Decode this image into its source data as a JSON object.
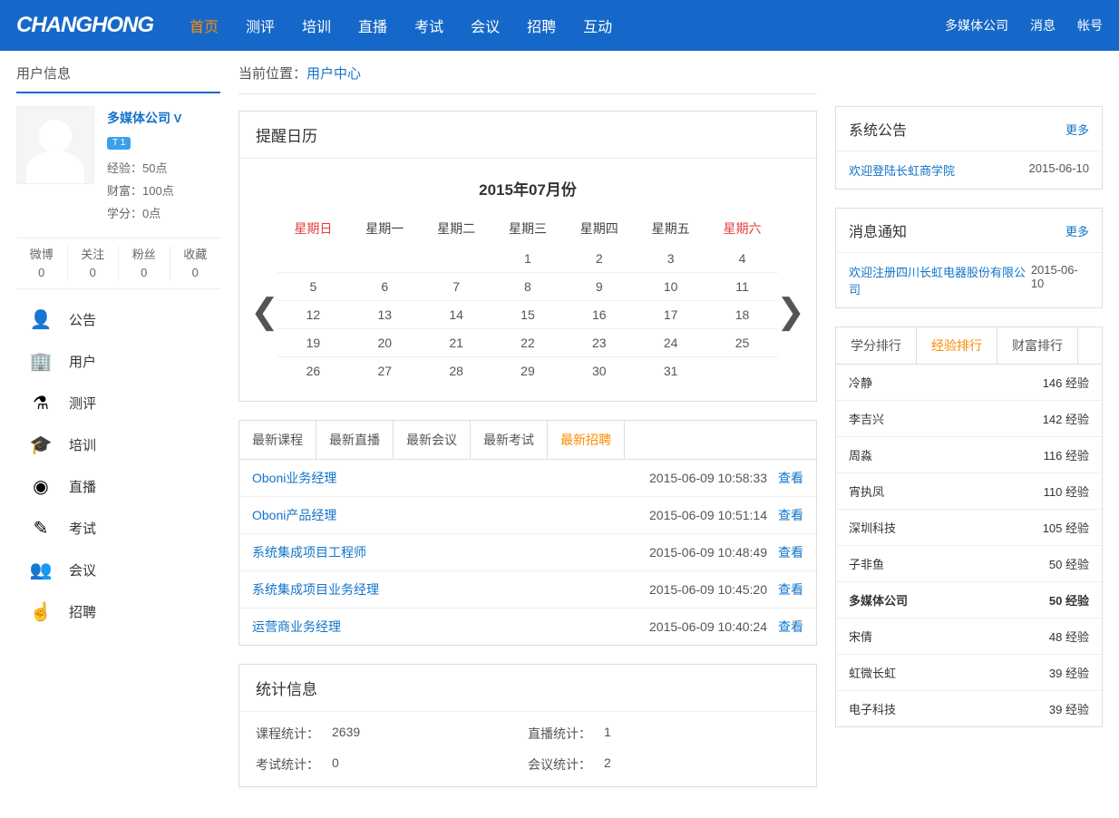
{
  "brand": "CHANGHONG",
  "nav": {
    "items": [
      {
        "label": "首页",
        "active": true
      },
      {
        "label": "测评"
      },
      {
        "label": "培训"
      },
      {
        "label": "直播"
      },
      {
        "label": "考试"
      },
      {
        "label": "会议"
      },
      {
        "label": "招聘"
      },
      {
        "label": "互动"
      }
    ],
    "right": [
      "多媒体公司",
      "消息",
      "帐号"
    ]
  },
  "breadcrumb": {
    "prefix": "当前位置：",
    "link": "用户中心"
  },
  "sidebar": {
    "title": "用户信息",
    "profile": {
      "name": "多媒体公司",
      "vbadge": "V",
      "level": "T 1",
      "exp_label": "经验：",
      "exp_val": "50点",
      "wealth_label": "财富：",
      "wealth_val": "100点",
      "credit_label": "学分：",
      "credit_val": "0点"
    },
    "social": [
      {
        "label": "微博",
        "val": "0"
      },
      {
        "label": "关注",
        "val": "0"
      },
      {
        "label": "粉丝",
        "val": "0"
      },
      {
        "label": "收藏",
        "val": "0"
      }
    ],
    "menu": [
      {
        "icon": "person-icon",
        "glyph": "👤",
        "label": "公告"
      },
      {
        "icon": "building-icon",
        "glyph": "🏢",
        "label": "用户"
      },
      {
        "icon": "flask-icon",
        "glyph": "⚗",
        "label": "测评"
      },
      {
        "icon": "grad-icon",
        "glyph": "🎓",
        "label": "培训"
      },
      {
        "icon": "play-icon",
        "glyph": "◉",
        "label": "直播"
      },
      {
        "icon": "pencil-icon",
        "glyph": "✎",
        "label": "考试"
      },
      {
        "icon": "group-icon",
        "glyph": "👥",
        "label": "会议"
      },
      {
        "icon": "pointer-icon",
        "glyph": "☝",
        "label": "招聘"
      }
    ]
  },
  "calendar": {
    "title": "提醒日历",
    "month": "2015年07月份",
    "weekdays": [
      "星期日",
      "星期一",
      "星期二",
      "星期三",
      "星期四",
      "星期五",
      "星期六"
    ],
    "rows": [
      [
        "",
        "",
        "",
        "1",
        "2",
        "3",
        "4"
      ],
      [
        "5",
        "6",
        "7",
        "8",
        "9",
        "10",
        "11"
      ],
      [
        "12",
        "13",
        "14",
        "15",
        "16",
        "17",
        "18"
      ],
      [
        "19",
        "20",
        "21",
        "22",
        "23",
        "24",
        "25"
      ],
      [
        "26",
        "27",
        "28",
        "29",
        "30",
        "31",
        ""
      ]
    ]
  },
  "latest": {
    "tabs": [
      "最新课程",
      "最新直播",
      "最新会议",
      "最新考试",
      "最新招聘"
    ],
    "active": 4,
    "view_label": "查看",
    "items": [
      {
        "title": "Oboni业务经理",
        "time": "2015-06-09 10:58:33"
      },
      {
        "title": "Oboni产品经理",
        "time": "2015-06-09 10:51:14"
      },
      {
        "title": "系统集成项目工程师",
        "time": "2015-06-09 10:48:49"
      },
      {
        "title": "系统集成项目业务经理",
        "time": "2015-06-09 10:45:20"
      },
      {
        "title": "运营商业务经理",
        "time": "2015-06-09 10:40:24"
      }
    ]
  },
  "stats": {
    "title": "统计信息",
    "cells": [
      {
        "label": "课程统计：",
        "val": "2639"
      },
      {
        "label": "直播统计：",
        "val": "1"
      },
      {
        "label": "考试统计：",
        "val": "0"
      },
      {
        "label": "会议统计：",
        "val": "2"
      }
    ]
  },
  "announce": {
    "title": "系统公告",
    "more": "更多",
    "items": [
      {
        "text": "欢迎登陆长虹商学院",
        "date": "2015-06-10"
      }
    ]
  },
  "msgs": {
    "title": "消息通知",
    "more": "更多",
    "items": [
      {
        "text": "欢迎注册四川长虹电器股份有限公司",
        "date": "2015-06-10"
      }
    ]
  },
  "rank": {
    "tabs": [
      "学分排行",
      "经验排行",
      "财富排行"
    ],
    "active": 1,
    "unit": "经验",
    "items": [
      {
        "name": "冷静",
        "val": "146"
      },
      {
        "name": "李吉兴",
        "val": "142"
      },
      {
        "name": "周淼",
        "val": "116"
      },
      {
        "name": "宵执凤",
        "val": "110"
      },
      {
        "name": "深圳科技",
        "val": "105"
      },
      {
        "name": "子非鱼",
        "val": "50"
      },
      {
        "name": "多媒体公司",
        "val": "50",
        "me": true
      },
      {
        "name": "宋倩",
        "val": "48"
      },
      {
        "name": "虹微长虹",
        "val": "39"
      },
      {
        "name": "电子科技",
        "val": "39"
      }
    ]
  }
}
